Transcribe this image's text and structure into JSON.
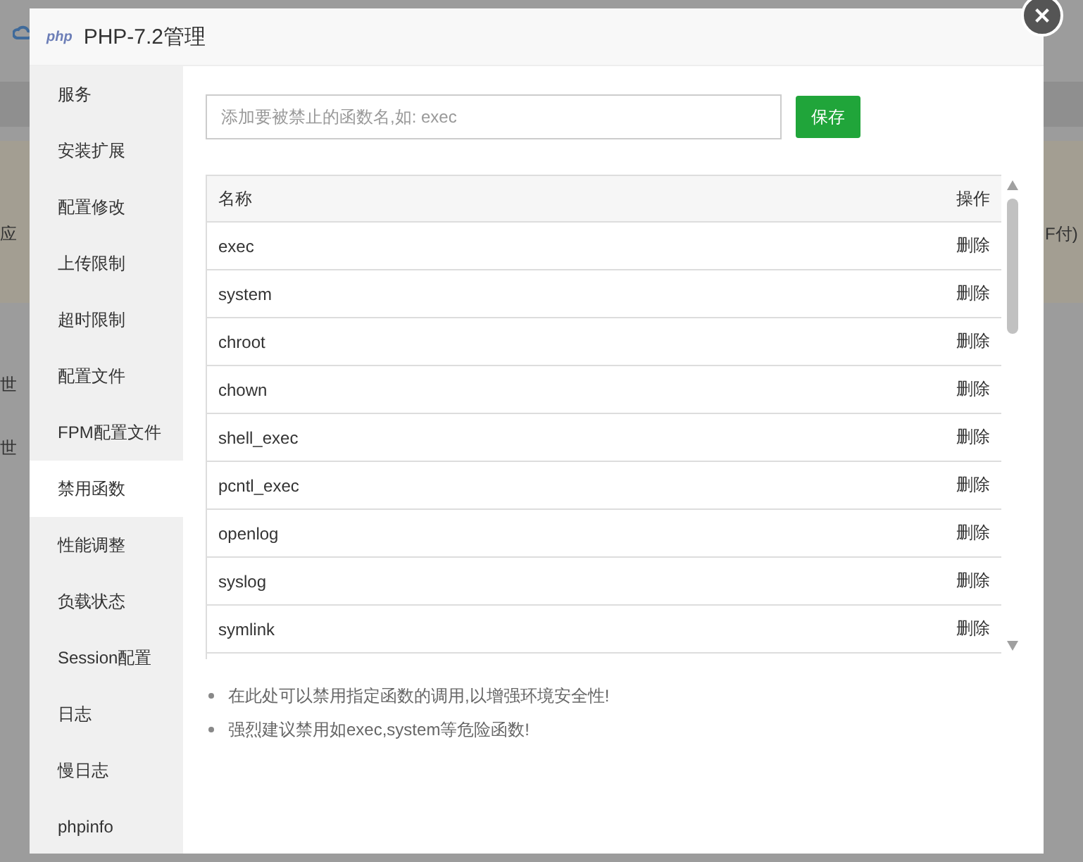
{
  "backdrop": {
    "fragments": [
      "应",
      "世",
      "世",
      "F付)"
    ]
  },
  "dialog": {
    "logo": "php",
    "title": "PHP-7.2管理",
    "sidebar": {
      "items": [
        {
          "label": "服务",
          "selected": false
        },
        {
          "label": "安装扩展",
          "selected": false
        },
        {
          "label": "配置修改",
          "selected": false
        },
        {
          "label": "上传限制",
          "selected": false
        },
        {
          "label": "超时限制",
          "selected": false
        },
        {
          "label": "配置文件",
          "selected": false
        },
        {
          "label": "FPM配置文件",
          "selected": false
        },
        {
          "label": "禁用函数",
          "selected": true
        },
        {
          "label": "性能调整",
          "selected": false
        },
        {
          "label": "负载状态",
          "selected": false
        },
        {
          "label": "Session配置",
          "selected": false
        },
        {
          "label": "日志",
          "selected": false
        },
        {
          "label": "慢日志",
          "selected": false
        },
        {
          "label": "phpinfo",
          "selected": false
        }
      ]
    },
    "input": {
      "placeholder": "添加要被禁止的函数名,如: exec"
    },
    "save_button": "保存",
    "table": {
      "columns": [
        "名称",
        "操作"
      ],
      "rows": [
        {
          "name": "exec",
          "action": "删除"
        },
        {
          "name": "system",
          "action": "删除"
        },
        {
          "name": "chroot",
          "action": "删除"
        },
        {
          "name": "chown",
          "action": "删除"
        },
        {
          "name": "shell_exec",
          "action": "删除"
        },
        {
          "name": "pcntl_exec",
          "action": "删除"
        },
        {
          "name": "openlog",
          "action": "删除"
        },
        {
          "name": "syslog",
          "action": "删除"
        },
        {
          "name": "symlink",
          "action": "删除"
        }
      ]
    },
    "notes": [
      "在此处可以禁用指定函数的调用,以增强环境安全性!",
      "强烈建议禁用如exec,system等危险函数!"
    ]
  }
}
